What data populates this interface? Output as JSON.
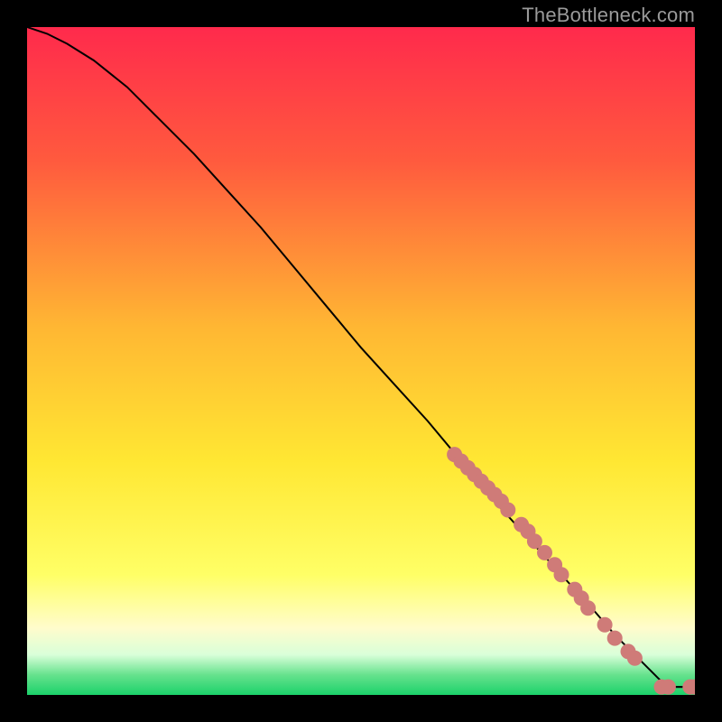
{
  "watermark": "TheBottleneck.com",
  "palette": {
    "bg": "#000000",
    "marker_fill": "#cf7b78",
    "marker_stroke": "#cf7b78",
    "line": "#000000",
    "gradient_stops": [
      {
        "pct": 0,
        "color": "#ff2a4c"
      },
      {
        "pct": 20,
        "color": "#ff5a3e"
      },
      {
        "pct": 45,
        "color": "#ffb733"
      },
      {
        "pct": 65,
        "color": "#ffe733"
      },
      {
        "pct": 82,
        "color": "#ffff66"
      },
      {
        "pct": 90,
        "color": "#fffccc"
      },
      {
        "pct": 94,
        "color": "#d9ffd9"
      },
      {
        "pct": 97,
        "color": "#66e28d"
      },
      {
        "pct": 100,
        "color": "#1bd16a"
      }
    ]
  },
  "chart_data": {
    "type": "line",
    "title": "",
    "xlabel": "",
    "ylabel": "",
    "xlim": [
      0,
      100
    ],
    "ylim": [
      0,
      100
    ],
    "grid": false,
    "legend": false,
    "series": [
      {
        "name": "bottleneck-curve",
        "x": [
          0,
          3,
          6,
          10,
          15,
          20,
          25,
          30,
          35,
          40,
          45,
          50,
          55,
          60,
          65,
          70,
          75,
          80,
          85,
          88,
          91,
          93.5,
          95,
          97,
          100
        ],
        "y": [
          100,
          99,
          97.5,
          95,
          91,
          86,
          81,
          75.5,
          70,
          64,
          58,
          52,
          46.5,
          41,
          35,
          29,
          23.5,
          18,
          12.5,
          9,
          6,
          3.5,
          2,
          1.2,
          1.2
        ]
      }
    ],
    "markers": [
      {
        "name": "cluster-upper-64-36",
        "x": 64,
        "y": 36
      },
      {
        "name": "cluster-upper-65-35",
        "x": 65,
        "y": 35
      },
      {
        "name": "cluster-upper-66-34",
        "x": 66,
        "y": 34
      },
      {
        "name": "cluster-upper-67-33",
        "x": 67,
        "y": 33
      },
      {
        "name": "cluster-upper-68-32",
        "x": 68,
        "y": 32
      },
      {
        "name": "cluster-upper-69-31",
        "x": 69,
        "y": 31
      },
      {
        "name": "cluster-upper-70-30",
        "x": 70,
        "y": 30
      },
      {
        "name": "cluster-upper-71-29",
        "x": 71,
        "y": 29
      },
      {
        "name": "cluster-upper-72-28",
        "x": 72,
        "y": 27.7
      },
      {
        "name": "cluster-mid-74-26",
        "x": 74,
        "y": 25.5
      },
      {
        "name": "cluster-mid-75-25",
        "x": 75,
        "y": 24.5
      },
      {
        "name": "cluster-mid-76-24",
        "x": 76,
        "y": 23.0
      },
      {
        "name": "cluster-mid-77-22",
        "x": 77.5,
        "y": 21.3
      },
      {
        "name": "cluster-mid-79-20",
        "x": 79,
        "y": 19.5
      },
      {
        "name": "cluster-mid-80-19",
        "x": 80,
        "y": 18.0
      },
      {
        "name": "cluster-low-82-16",
        "x": 82,
        "y": 15.8
      },
      {
        "name": "cluster-low-83-15",
        "x": 83,
        "y": 14.5
      },
      {
        "name": "cluster-low-84-14",
        "x": 84,
        "y": 13.0
      },
      {
        "name": "cluster-low-86-11",
        "x": 86.5,
        "y": 10.5
      },
      {
        "name": "cluster-low-88-9",
        "x": 88,
        "y": 8.5
      },
      {
        "name": "cluster-bottom-90-6",
        "x": 90,
        "y": 6.5
      },
      {
        "name": "cluster-bottom-91-5",
        "x": 91,
        "y": 5.5
      },
      {
        "name": "end-95-1",
        "x": 95,
        "y": 1.2
      },
      {
        "name": "end-96-1",
        "x": 96,
        "y": 1.2
      },
      {
        "name": "end-99-1",
        "x": 99.3,
        "y": 1.2
      },
      {
        "name": "end-100-1",
        "x": 100,
        "y": 1.2
      }
    ],
    "marker_radius": 8
  }
}
